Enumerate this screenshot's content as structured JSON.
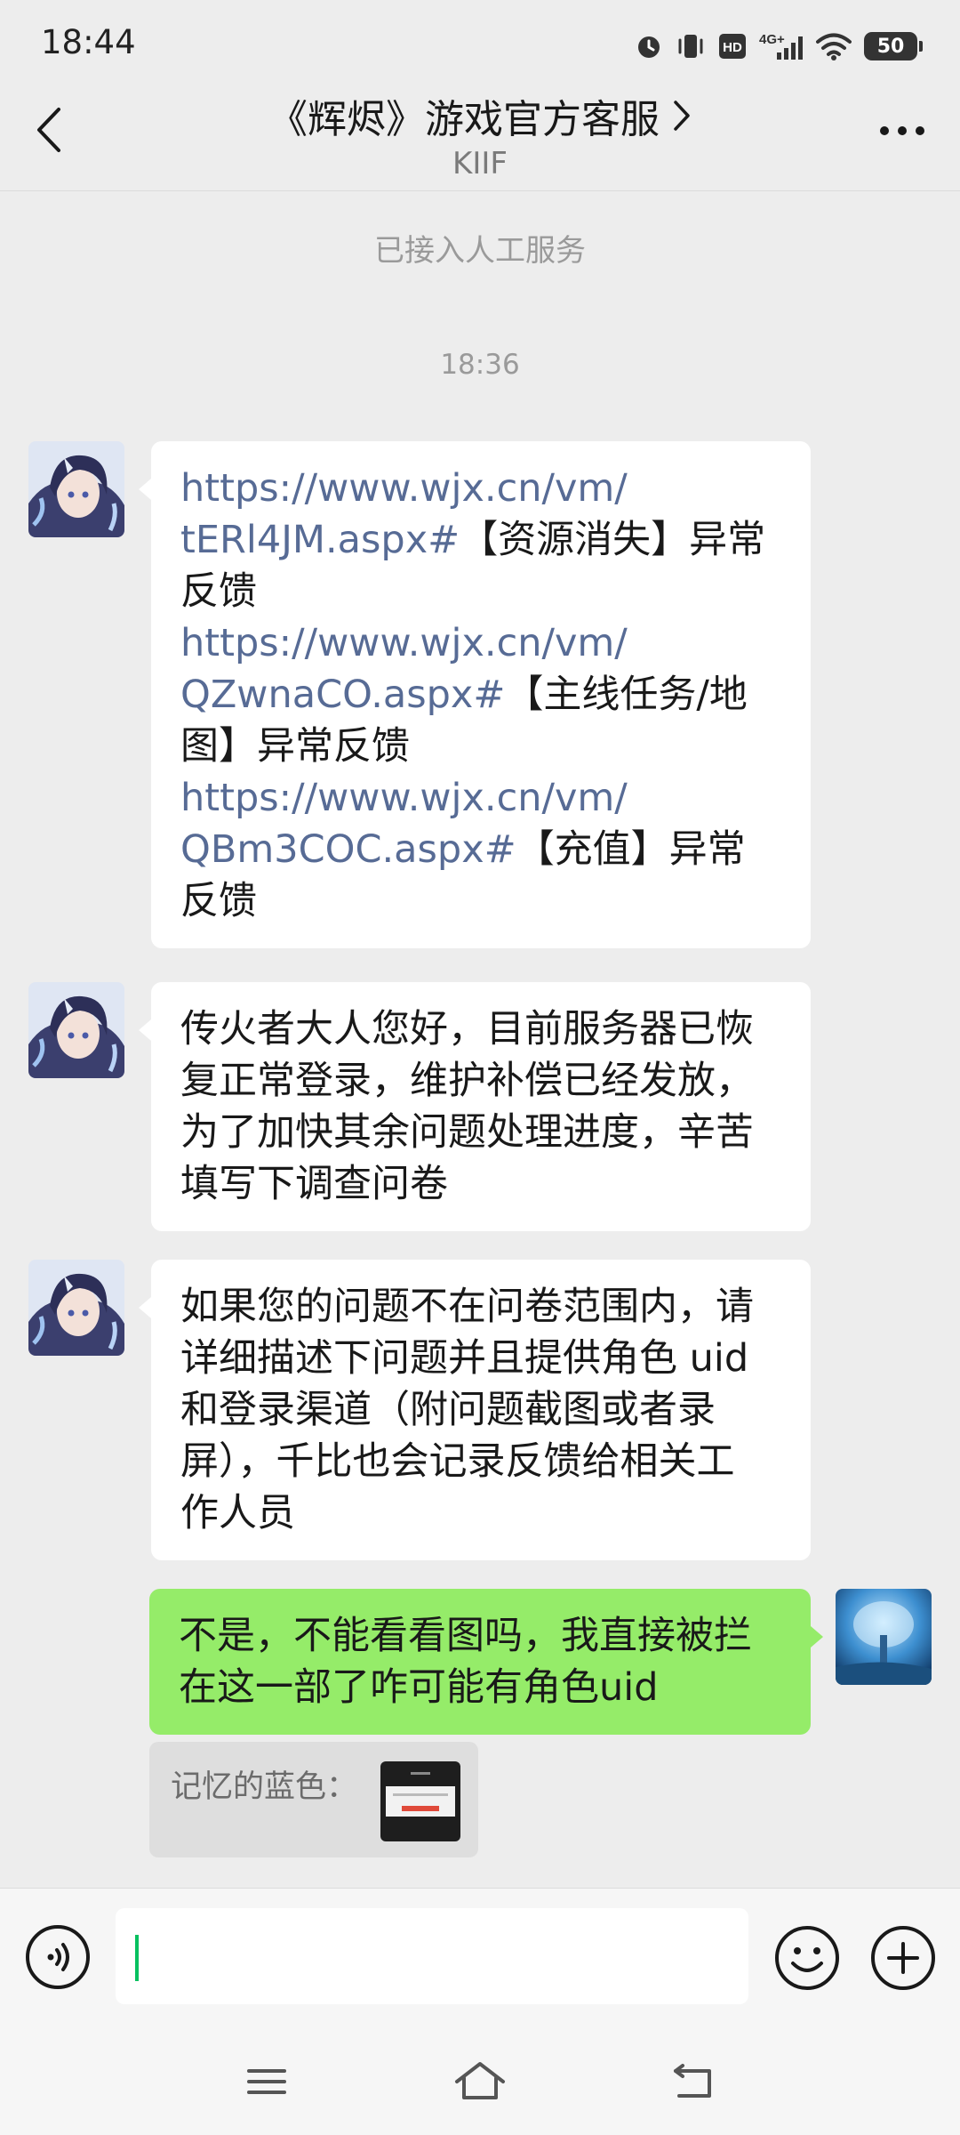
{
  "status_bar": {
    "time": "18:44",
    "battery": "50"
  },
  "header": {
    "title": "《辉烬》游戏官方客服",
    "subtitle": "KIIF"
  },
  "chat": {
    "system_notice": "已接入人工服务",
    "timestamp": "18:36",
    "messages": [
      {
        "sender": "agent",
        "links": [
          {
            "url_line1": "https://www.wjx.cn/vm/",
            "url_line2": "tERl4JM.aspx#",
            "tail_a": "【资源消失】异常",
            "tail_b": "反馈"
          },
          {
            "url_line1": "https://www.wjx.cn/vm/",
            "url_line2": "QZwnaCO.aspx#",
            "tail_a": "【主线任务/地",
            "tail_b": "图】异常反馈"
          },
          {
            "url_line1": "https://www.wjx.cn/vm/",
            "url_line2": "QBm3COC.aspx#",
            "tail_a": "【充值】异常",
            "tail_b": "反馈"
          }
        ]
      },
      {
        "sender": "agent",
        "lines": [
          "传火者大人您好，目前服务器已恢",
          "复正常登录，维护补偿已经发放，",
          "为了加快其余问题处理进度，辛苦",
          "填写下调查问卷"
        ]
      },
      {
        "sender": "agent",
        "lines": [
          "如果您的问题不在问卷范围内，请",
          "详细描述下问题并且提供角色 uid",
          "和登录渠道（附问题截图或者录",
          "屏），千比也会记录反馈给相关工",
          "作人员"
        ]
      },
      {
        "sender": "user",
        "lines": [
          "不是，不能看看图吗，我直接被拦",
          "在这一部了咋可能有角色uid"
        ]
      }
    ],
    "quote": {
      "label": "记忆的蓝色："
    }
  },
  "input_bar": {
    "value": ""
  },
  "icons": {
    "back": "chevron-left-icon",
    "more": "more-dots-icon",
    "voice": "voice-icon",
    "emoji": "emoji-icon",
    "plus": "plus-icon",
    "nav_menu": "menu-icon",
    "nav_home": "home-icon",
    "nav_back": "back-nav-icon"
  },
  "colors": {
    "background": "#ededed",
    "user_bubble": "#95ec69",
    "agent_bubble": "#ffffff",
    "link": "#576b95",
    "cursor": "#07c160"
  }
}
